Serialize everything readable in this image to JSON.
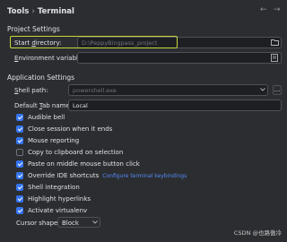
{
  "header": {
    "breadcrumb_parent": "Tools",
    "breadcrumb_separator": "›",
    "breadcrumb_current": "Terminal",
    "back_icon": "arrow-left-icon",
    "forward_icon": "arrow-right-icon",
    "back_glyph": "←",
    "forward_glyph": "→"
  },
  "project_settings": {
    "title": "Project Settings",
    "start_dir_label_pre": "Start ",
    "start_dir_label_u": "d",
    "start_dir_label_post": "irectory:",
    "start_dir_value": "D:\\PeppyBingpass_project",
    "env_label_pre": "",
    "env_label_u": "E",
    "env_label_post": "nvironment variables:",
    "env_value": ""
  },
  "application_settings": {
    "title": "Application Settings",
    "shell_label_pre": "",
    "shell_label_u": "S",
    "shell_label_post": "hell path:",
    "shell_value": "powershell.exe",
    "tab_label_pre": "Default ",
    "tab_label_u": "T",
    "tab_label_post": "ab name:",
    "tab_value": "Local",
    "options": [
      {
        "label": "Audible bell",
        "checked": true
      },
      {
        "label": "Close session when it ends",
        "checked": true
      },
      {
        "label": "Mouse reporting",
        "checked": true
      },
      {
        "label": "Copy to clipboard on selection",
        "checked": false
      },
      {
        "label": "Paste on middle mouse button click",
        "checked": true
      },
      {
        "label": "Override IDE shortcuts",
        "checked": true,
        "link": "Configure terminal keybindings"
      },
      {
        "label": "Shell integration",
        "checked": true
      },
      {
        "label": "Highlight hyperlinks",
        "checked": true
      },
      {
        "label": "Activate virtualenv",
        "checked": true
      }
    ],
    "cursor_label": "Cursor shape:",
    "cursor_value": "Block"
  },
  "icons": {
    "folder": "folder-icon",
    "env_edit": "edit-document-icon",
    "dropdown": "chevron-down-icon",
    "browse_glyph": "..."
  },
  "colors": {
    "background": "#2b2d30",
    "accent": "#3574f0",
    "highlight_box": "#c7d63f",
    "link": "#548af7"
  },
  "watermark": "CSDN @也路傲冷"
}
